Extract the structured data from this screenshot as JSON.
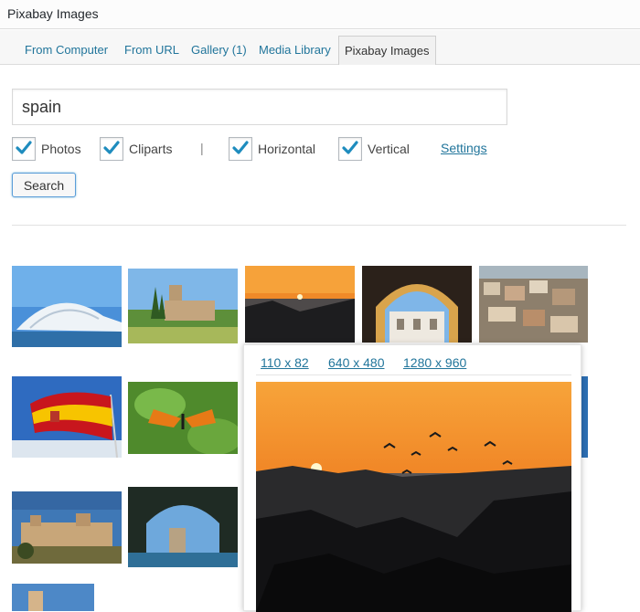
{
  "window": {
    "title": "Pixabay Images"
  },
  "tabs": [
    {
      "label": "From Computer"
    },
    {
      "label": "From URL"
    },
    {
      "label": "Gallery (1)"
    },
    {
      "label": "Media Library"
    },
    {
      "label": "Pixabay Images",
      "active": true
    }
  ],
  "search": {
    "value": "spain",
    "button_label": "Search"
  },
  "filters": {
    "photos": {
      "label": "Photos",
      "checked": true
    },
    "cliparts": {
      "label": "Cliparts",
      "checked": true
    },
    "separator": "|",
    "horizontal": {
      "label": "Horizontal",
      "checked": true
    },
    "vertical": {
      "label": "Vertical",
      "checked": true
    },
    "settings_link": "Settings"
  },
  "results": [
    {
      "subject": "modern white arched architecture over water"
    },
    {
      "subject": "castle with cypress trees"
    },
    {
      "subject": "sunset over rocky coast with birds"
    },
    {
      "subject": "moorish arch with palace"
    },
    {
      "subject": "town of houses on hillside"
    },
    {
      "subject": "flag of spain"
    },
    {
      "subject": "monarch butterfly on leaf"
    },
    {
      "subject": "partially hidden image"
    },
    {
      "subject": "walled village on hill"
    },
    {
      "subject": "stone tower framed by tree"
    },
    {
      "subject": "partially visible image"
    }
  ],
  "preview": {
    "sizes": [
      "110 x 82",
      "640 x 480",
      "1280 x 960"
    ],
    "subject": "sunset over rocky coast with birds"
  },
  "colors": {
    "link": "#21759b",
    "checkmark": "#1e8cbe",
    "button_focus": "#5b9dd9"
  }
}
